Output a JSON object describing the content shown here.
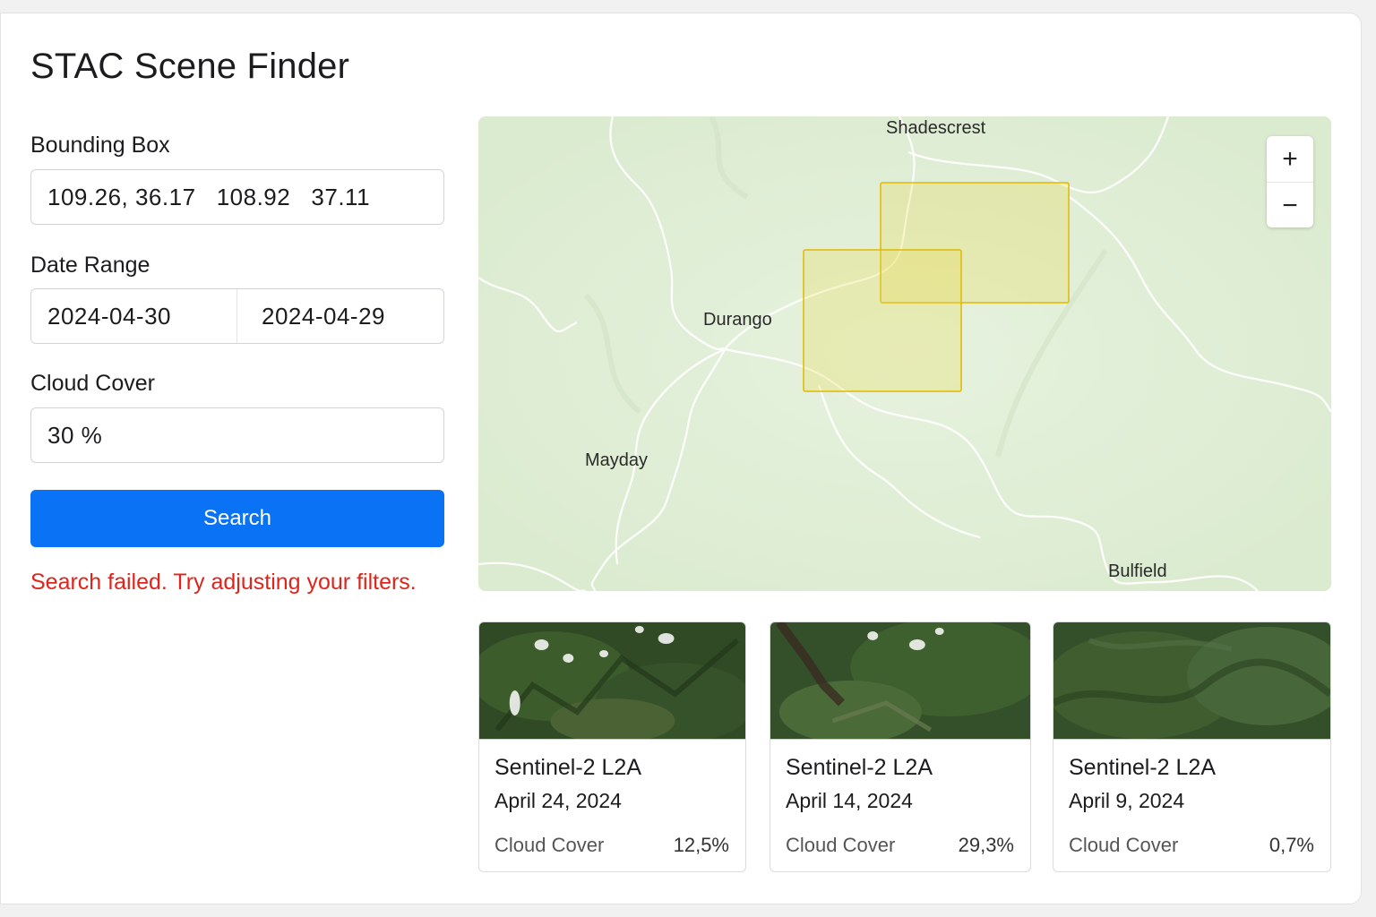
{
  "app": {
    "title": "STAC Scene Finder"
  },
  "filters": {
    "bbox": {
      "label": "Bounding Box",
      "value": "109.26, 36.17   108.92   37.11"
    },
    "date_range": {
      "label": "Date Range",
      "start": "2024-04-30",
      "end": "2024-04-29"
    },
    "cloud_cover": {
      "label": "Cloud Cover",
      "value": "30 %"
    },
    "search_label": "Search",
    "error": "Search failed. Try adjusting your filters."
  },
  "map": {
    "places": [
      "Shadescrest",
      "Durango",
      "Mayday",
      "Bulfield"
    ],
    "zoom_in": "+",
    "zoom_out": "−",
    "footprint_color": "#e8d64a"
  },
  "results": [
    {
      "collection": "Sentinel-2 L2A",
      "date": "April 24, 2024",
      "cloud_label": "Cloud Cover",
      "cloud_value": "12,5%"
    },
    {
      "collection": "Sentinel-2 L2A",
      "date": "April 14, 2024",
      "cloud_label": "Cloud Cover",
      "cloud_value": "29,3%"
    },
    {
      "collection": "Sentinel-2 L2A",
      "date": "April 9, 2024",
      "cloud_label": "Cloud Cover",
      "cloud_value": "0,7%"
    }
  ],
  "colors": {
    "accent": "#0a73f5",
    "error": "#e0241b",
    "map_bg": "#e3f0d9"
  }
}
